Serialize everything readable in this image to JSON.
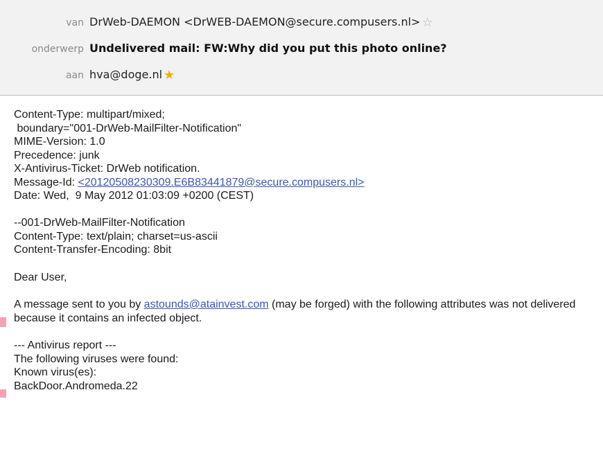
{
  "header": {
    "from_label": "van",
    "from_value": "DrWeb-DAEMON <DrWEB-DAEMON@secure.compusers.nl>",
    "subject_label": "onderwerp",
    "subject_value": "Undelivered mail: FW:Why did you put this photo online?",
    "to_label": "aan",
    "to_value": "hva@doge.nl"
  },
  "body": {
    "line1": "Content-Type: multipart/mixed;",
    "line2": " boundary=\"001-DrWeb-MailFilter-Notification\"",
    "line3": "MIME-Version: 1.0",
    "line4": "Precedence: junk",
    "line5": "X-Antivirus-Ticket: DrWeb notification.",
    "message_id_label": "Message-Id: ",
    "message_id_link": "<20120508230309.E6B83441879@secure.compusers.nl>",
    "date_line": "Date: Wed,  9 May 2012 01:03:09 +0200 (CEST)",
    "boundary_line": "--001-DrWeb-MailFilter-Notification",
    "content_type_plain": "Content-Type: text/plain; charset=us-ascii",
    "transfer_encoding": "Content-Transfer-Encoding: 8bit",
    "greeting": "Dear User,",
    "msg_prefix": "A message sent to you by ",
    "sender_link": "astounds@atainvest.com",
    "msg_suffix": " (may be forged) with the following attributes was not delivered because it contains an infected object.",
    "report_header": "--- Antivirus report ---",
    "viruses_found": "The following viruses were found:",
    "known_virus": "Known virus(es):",
    "virus_name": "BackDoor.Andromeda.22"
  },
  "icons": {
    "from_star": "star-outline-icon",
    "to_star": "star-filled-icon"
  },
  "colors": {
    "link": "#3b55b8",
    "header_bg": "#f2f2f3",
    "star_filled": "#f0b000"
  }
}
